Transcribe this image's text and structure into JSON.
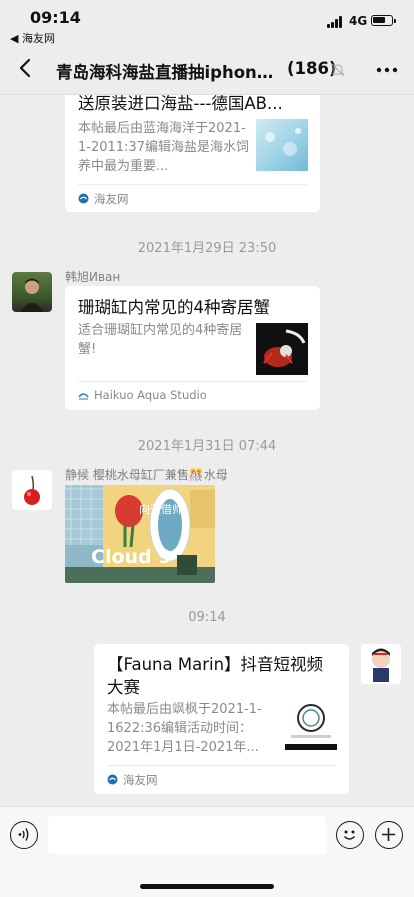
{
  "status_bar": {
    "time": "09:14",
    "back_app": "◀ 海友网",
    "network": "4G"
  },
  "nav": {
    "title": "青岛海科海盐直播抽iphone...",
    "member_count": "(186)"
  },
  "messages": [
    {
      "kind": "link-card",
      "title": "送原装进口海盐---德国AB...",
      "desc": "本帖最后由蓝海海洋于2021-1-2011:37编辑海盐是海水饲养中最为重要...",
      "source": "海友网",
      "thumb": "blue-salt-image"
    },
    {
      "kind": "timestamp",
      "text": "2021年1月29日 23:50"
    },
    {
      "kind": "link-card",
      "sender": "韩旭Иван",
      "title": "珊瑚缸内常见的4种寄居蟹",
      "desc": "适合珊瑚缸内常见的4种寄居蟹!",
      "source": "Haikuo Aqua Studio",
      "thumb": "hermit-crab-image"
    },
    {
      "kind": "timestamp",
      "text": "2021年1月31日 07:44"
    },
    {
      "kind": "image",
      "sender": "静候   樱桃水母缸厂兼售🎊水母",
      "sign_text": "Cloud 9",
      "sign_cn": "向天借帅"
    },
    {
      "kind": "timestamp",
      "text": "09:14"
    },
    {
      "kind": "link-card",
      "title": "【Fauna Marin】抖音短视频大赛",
      "desc": "本帖最后由飒枫于2021-1-1622:36编辑活动时间：2021年1月1日-2021年...",
      "source": "海友网",
      "thumb": "fauna-marin-logo"
    }
  ],
  "input": {
    "placeholder": ""
  },
  "colors": {
    "chat_bg": "#ededed",
    "card_bg": "#ffffff",
    "muted_text": "#8a8a8a"
  }
}
